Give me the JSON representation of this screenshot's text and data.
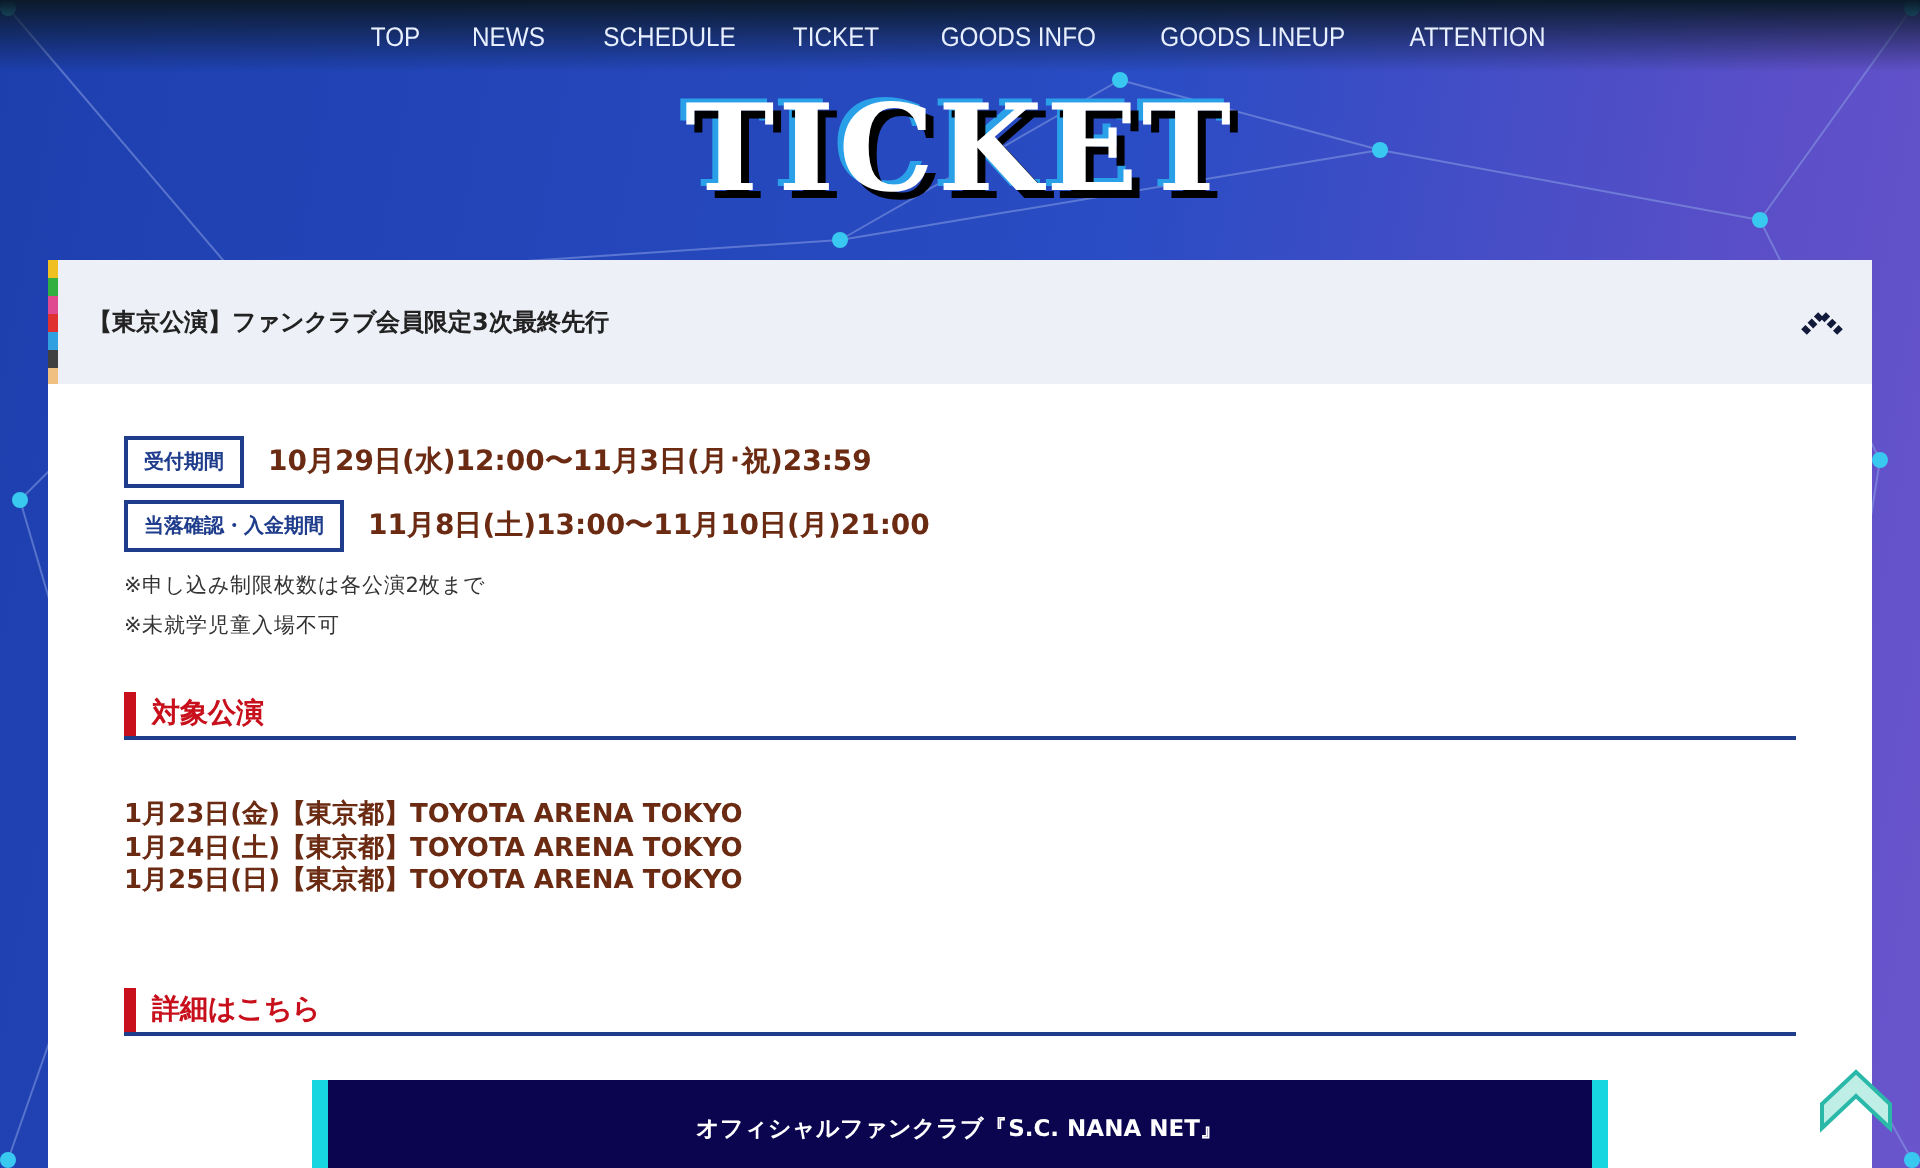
{
  "nav": [
    "TOP",
    "NEWS",
    "SCHEDULE",
    "TICKET",
    "GOODS INFO",
    "GOODS LINEUP",
    "ATTENTION"
  ],
  "page_title": "TICKET",
  "accordion": {
    "title": "【東京公演】ファンクラブ会員限定3次最終先行",
    "expanded": true,
    "periods": [
      {
        "label": "受付期間",
        "value": "10月29日(水)12:00〜11月3日(月･祝)23:59"
      },
      {
        "label": "当落確認・入金期間",
        "value": "11月8日(土)13:00〜11月10日(月)21:00"
      }
    ],
    "notes": [
      "※申し込み制限枚数は各公演2枚まで",
      "※未就学児童入場不可"
    ],
    "sections": [
      {
        "heading": "対象公演",
        "lines": [
          "1月23日(金)【東京都】TOYOTA ARENA TOKYO",
          "1月24日(土)【東京都】TOYOTA ARENA TOKYO",
          "1月25日(日)【東京都】TOYOTA ARENA TOKYO"
        ]
      },
      {
        "heading": "詳細はこちら",
        "button": "オフィシャルファンクラブ『S.C. NANA NET』"
      }
    ]
  }
}
